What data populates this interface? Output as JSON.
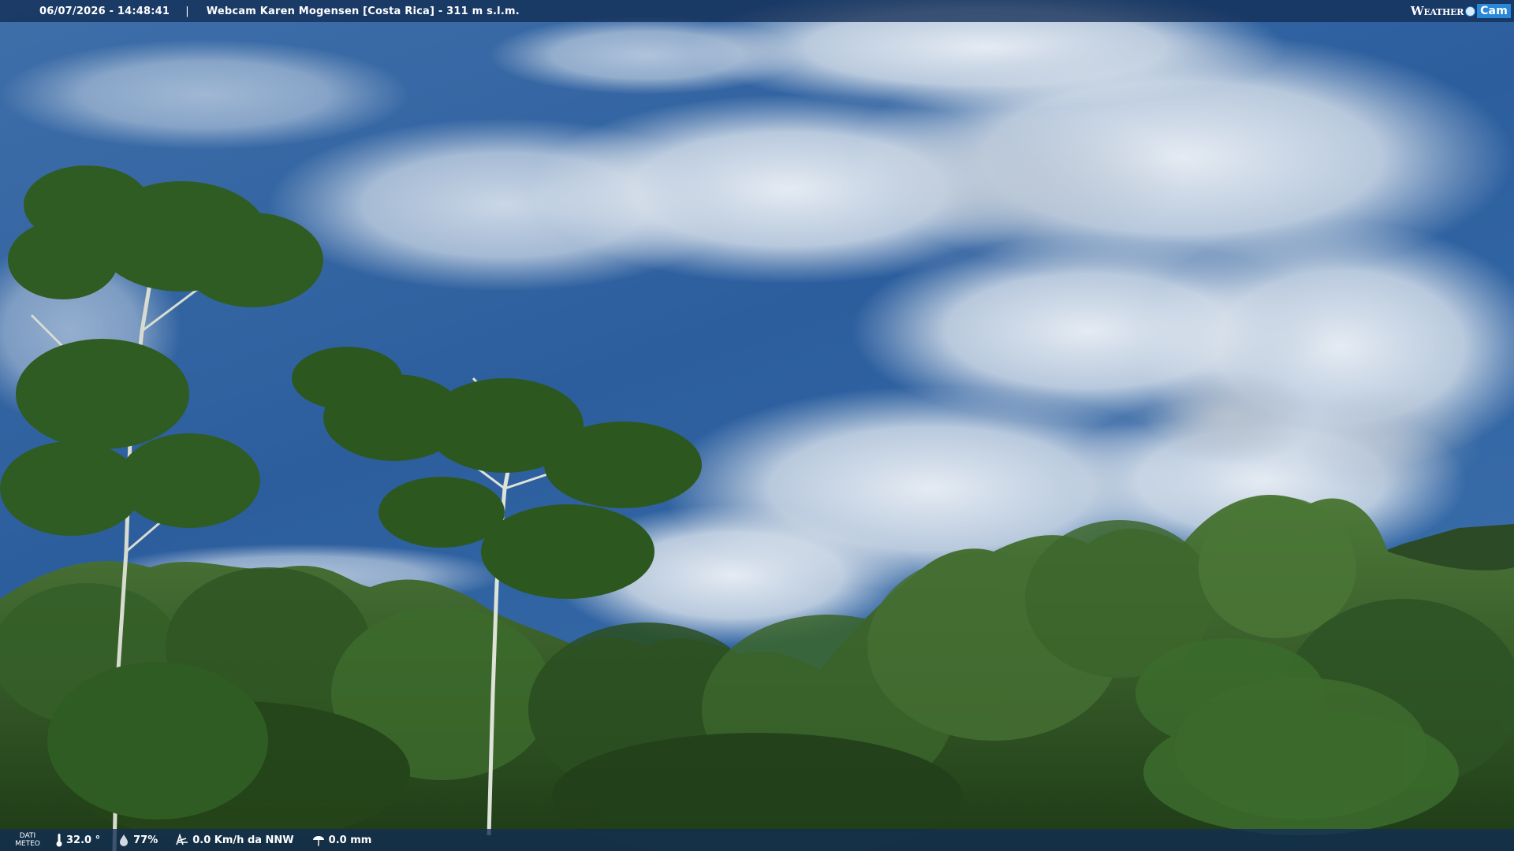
{
  "header": {
    "timestamp": "06/07/2026 - 14:48:41",
    "separator": "|",
    "location": "Webcam Karen Mogensen [Costa Rica]  - 311 m s.l.m.",
    "logo_word": "Weather",
    "logo_cam": "Cam"
  },
  "footer": {
    "label_line1": "DATI",
    "label_line2": "METEO",
    "temperature": "32.0 °",
    "humidity": "77%",
    "wind": "0.0 Km/h da NNW",
    "rain": "0.0 mm"
  },
  "icons": {
    "temperature": "thermometer-icon",
    "humidity": "humidity-drop-icon",
    "wind": "wind-icon",
    "rain": "rain-icon"
  },
  "colors": {
    "sky": "#2f65a6",
    "bar": "#122d55",
    "forest": "#2a4a1e",
    "logo_accent": "#2a88d8"
  }
}
